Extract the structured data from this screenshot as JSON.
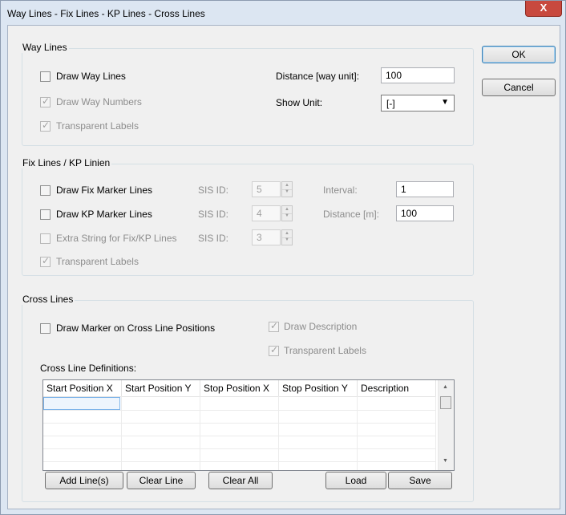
{
  "window": {
    "title": "Way Lines - Fix Lines - KP Lines - Cross Lines",
    "close_symbol": "X"
  },
  "buttons": {
    "ok": "OK",
    "cancel": "Cancel"
  },
  "way_lines": {
    "group_title": "Way Lines",
    "draw_way_lines": "Draw Way Lines",
    "draw_way_numbers": "Draw Way Numbers",
    "transparent_labels": "Transparent Labels",
    "distance_label": "Distance [way unit]:",
    "distance_value": "100",
    "show_unit_label": "Show Unit:",
    "show_unit_value": "[-]"
  },
  "fix_lines": {
    "group_title": "Fix Lines / KP Linien",
    "draw_fix": "Draw Fix Marker Lines",
    "draw_kp": "Draw KP Marker Lines",
    "extra_string": "Extra String for Fix/KP Lines",
    "transparent_labels": "Transparent Labels",
    "sis_label": "SIS ID:",
    "sis_fix": "5",
    "sis_kp": "4",
    "sis_extra": "3",
    "interval_label": "Interval:",
    "interval_value": "1",
    "distance_label": "Distance [m]:",
    "distance_value": "100"
  },
  "cross_lines": {
    "group_title": "Cross Lines",
    "draw_marker": "Draw Marker on Cross Line Positions",
    "draw_description": "Draw Description",
    "transparent_labels": "Transparent Labels",
    "definitions_label": "Cross Line Definitions:",
    "columns": [
      "Start Position X",
      "Start Position Y",
      "Stop Position X",
      "Stop Position Y",
      "Description"
    ],
    "buttons": {
      "add": "Add Line(s)",
      "clear_line": "Clear Line",
      "clear_all": "Clear All",
      "load": "Load",
      "save": "Save"
    }
  },
  "checks": {
    "draw_way_lines": false,
    "draw_way_numbers": true,
    "way_transparent": true,
    "draw_fix": false,
    "draw_kp": false,
    "extra_string": false,
    "fix_transparent": true,
    "draw_marker": false,
    "draw_description": true,
    "cross_transparent": true
  },
  "colors": {
    "close_button": "#c8493e",
    "title_bar": "#dce6f2",
    "dialog_bg": "#f0f0f0"
  }
}
